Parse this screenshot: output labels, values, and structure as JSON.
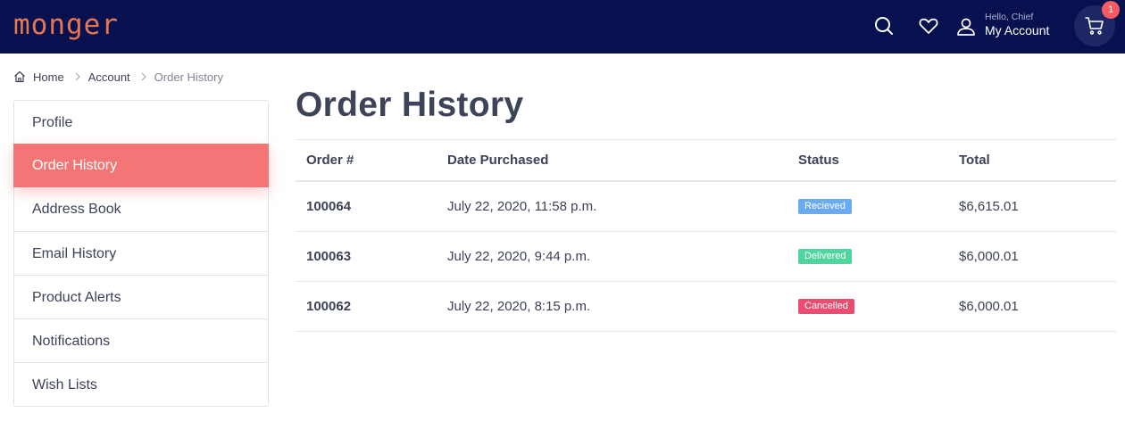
{
  "header": {
    "logo": "monger",
    "greeting": "Hello, Chief",
    "account_label": "My Account",
    "cart_count": "1",
    "icons": [
      "search-icon",
      "heart-icon",
      "user-icon",
      "cart-icon"
    ],
    "colors": {
      "bar": "#081150",
      "logo": "#e8774f",
      "badge": "#f45b62"
    }
  },
  "breadcrumb": {
    "items": [
      "Home",
      "Account",
      "Order History"
    ]
  },
  "sidebar": {
    "items": [
      {
        "label": "Profile"
      },
      {
        "label": "Order History",
        "active": true
      },
      {
        "label": "Address Book"
      },
      {
        "label": "Email History"
      },
      {
        "label": "Product Alerts"
      },
      {
        "label": "Notifications"
      },
      {
        "label": "Wish Lists"
      }
    ],
    "active_color": "#f47576"
  },
  "main": {
    "title": "Order History",
    "columns": [
      "Order #",
      "Date Purchased",
      "Status",
      "Total"
    ],
    "orders": [
      {
        "number": "100064",
        "date": "July 22, 2020, 11:58 p.m.",
        "status": "Recieved",
        "status_color": "#6aaaf0",
        "total": "$6,615.01"
      },
      {
        "number": "100063",
        "date": "July 22, 2020, 9:44 p.m.",
        "status": "Delivered",
        "status_color": "#4fd69c",
        "total": "$6,000.01"
      },
      {
        "number": "100062",
        "date": "July 22, 2020, 8:15 p.m.",
        "status": "Cancelled",
        "status_color": "#ec4c72",
        "total": "$6,000.01"
      }
    ]
  }
}
